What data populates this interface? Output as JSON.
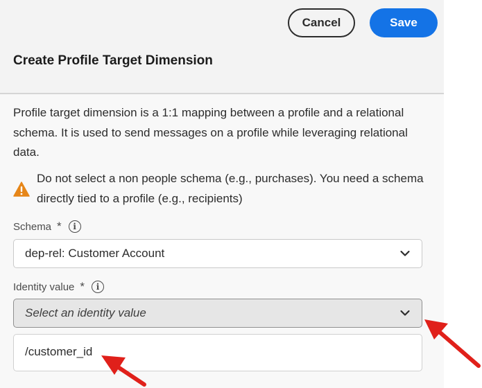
{
  "header": {
    "cancel_label": "Cancel",
    "save_label": "Save",
    "title": "Create Profile Target Dimension"
  },
  "description": "Profile target dimension is a 1:1 mapping between a profile and a relational schema. It is used to send messages on a profile while leveraging relational data.",
  "warning": {
    "icon": "alert-triangle-icon",
    "text": "Do not select a non people schema (e.g., purchases). You need a schema directly tied to a profile (e.g., recipients)"
  },
  "schema": {
    "label": "Schema",
    "required_mark": "*",
    "value": "dep-rel: Customer Account"
  },
  "identity": {
    "label": "Identity value",
    "required_mark": "*",
    "placeholder": "Select an identity value",
    "options": [
      "/customer_id"
    ]
  },
  "colors": {
    "primary": "#1473e6",
    "warning": "#e68619",
    "annotation_arrow": "#e0201a"
  }
}
